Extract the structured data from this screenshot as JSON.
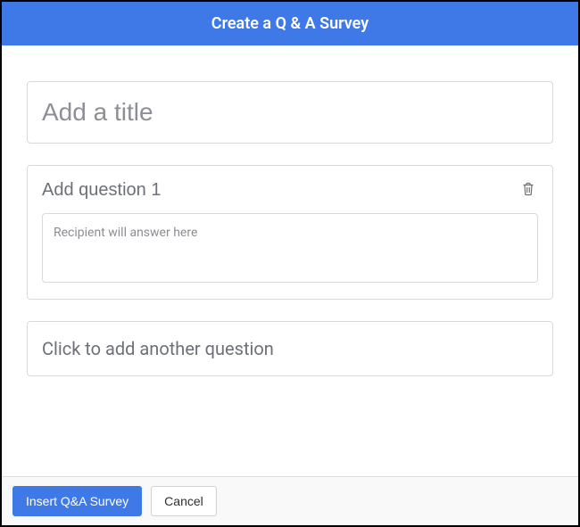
{
  "header": {
    "title": "Create a Q & A Survey"
  },
  "survey": {
    "title_placeholder": "Add a title",
    "title_value": "",
    "questions": [
      {
        "label_placeholder": "Add question 1",
        "label_value": "",
        "answer_placeholder": "Recipient will answer here"
      }
    ],
    "add_another": "Click to add another question"
  },
  "footer": {
    "insert_label": "Insert Q&A Survey",
    "cancel_label": "Cancel"
  }
}
